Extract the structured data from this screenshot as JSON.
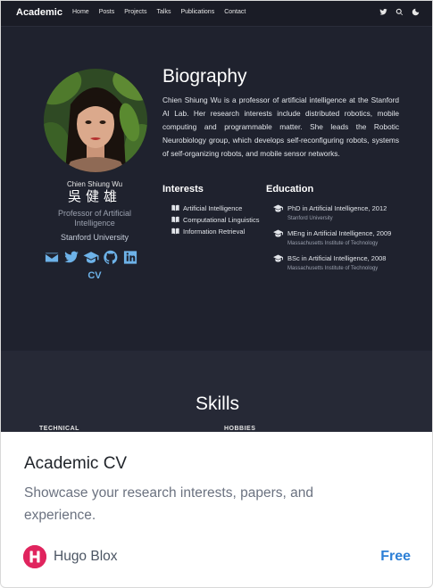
{
  "preview": {
    "navbar": {
      "brand": "Academic",
      "links": [
        "Home",
        "Posts",
        "Projects",
        "Talks",
        "Publications",
        "Contact"
      ],
      "icons": [
        "twitter-icon",
        "search-icon",
        "moon-icon"
      ]
    },
    "profile": {
      "name": "Chien Shiung Wu",
      "name_zh": "吳健雄",
      "role": "Professor of Artificial Intelligence",
      "university": "Stanford University",
      "social_icons": [
        "envelope-icon",
        "twitter-icon",
        "graduation-cap-icon",
        "github-icon",
        "linkedin-icon"
      ],
      "cv_label": "CV"
    },
    "biography": {
      "title": "Biography",
      "text": "Chien Shiung Wu is a professor of artificial intelligence at the Stanford AI Lab. Her research interests include distributed robotics, mobile computing and programmable matter. She leads the Robotic Neurobiology group, which develops self-reconfiguring robots, systems of self-organizing robots, and mobile sensor networks."
    },
    "interests": {
      "title": "Interests",
      "items": [
        "Artificial Intelligence",
        "Computational Linguistics",
        "Information Retrieval"
      ]
    },
    "education": {
      "title": "Education",
      "items": [
        {
          "degree": "PhD in Artificial Intelligence, 2012",
          "institution": "Stanford University"
        },
        {
          "degree": "MEng in Artificial Intelligence, 2009",
          "institution": "Massachusetts Institute of Technology"
        },
        {
          "degree": "BSc in Artificial Intelligence, 2008",
          "institution": "Massachusetts Institute of Technology"
        }
      ]
    },
    "skills": {
      "title": "Skills",
      "technical": "TECHNICAL",
      "hobbies": "HOBBIES"
    }
  },
  "card": {
    "title": "Academic CV",
    "description": "Showcase your research interests, papers, and experience.",
    "publisher": "Hugo Blox",
    "logo_letter": "H",
    "price": "Free"
  },
  "colors": {
    "preview_bg": "#1f222e",
    "accent": "#6db2e8",
    "logo": "#e0245e",
    "price": "#2c7fd6"
  }
}
